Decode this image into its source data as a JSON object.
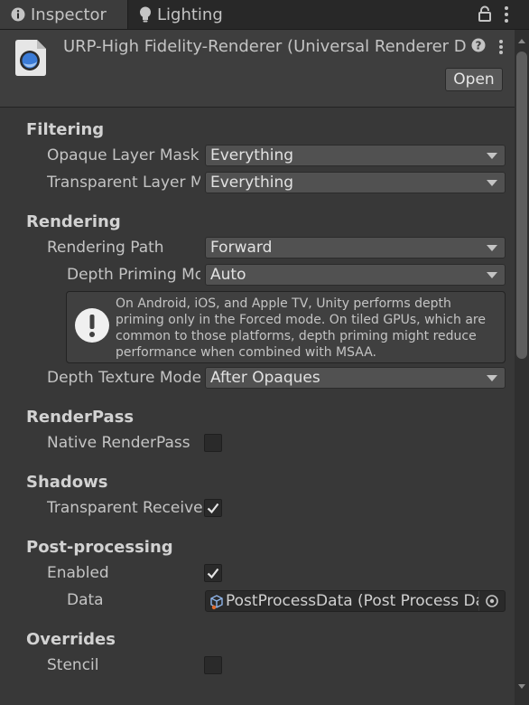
{
  "tabs": [
    {
      "label": "Inspector",
      "icon": "info-icon",
      "active": true
    },
    {
      "label": "Lighting",
      "icon": "lightbulb-icon",
      "active": false
    }
  ],
  "header": {
    "title": "URP-High Fidelity-Renderer (Universal Renderer Data)",
    "open_label": "Open"
  },
  "sections": {
    "filtering": "Filtering",
    "rendering": "Rendering",
    "renderpass": "RenderPass",
    "shadows": "Shadows",
    "postprocessing": "Post-processing",
    "overrides": "Overrides"
  },
  "fields": {
    "opaque_layer_mask": {
      "label": "Opaque Layer Mask",
      "value": "Everything"
    },
    "transparent_layer_mask": {
      "label": "Transparent Layer Mask",
      "value": "Everything"
    },
    "rendering_path": {
      "label": "Rendering Path",
      "value": "Forward"
    },
    "depth_priming_mode": {
      "label": "Depth Priming Mode",
      "value": "Auto"
    },
    "depth_texture_mode": {
      "label": "Depth Texture Mode",
      "value": "After Opaques"
    },
    "native_renderpass": {
      "label": "Native RenderPass",
      "checked": false
    },
    "transparent_receive_shadows": {
      "label": "Transparent Receive Shadows",
      "checked": true
    },
    "pp_enabled": {
      "label": "Enabled",
      "checked": true
    },
    "pp_data": {
      "label": "Data",
      "value": "PostProcessData (Post Process Data)"
    },
    "stencil": {
      "label": "Stencil",
      "checked": false
    }
  },
  "help_message": "On Android, iOS, and Apple TV, Unity performs depth priming only in the Forced mode. On tiled GPUs, which are common to those platforms, depth priming might reduce performance when combined with MSAA.",
  "colors": {
    "background": "#383838",
    "header": "#3e3e3e",
    "tabbar": "#282828",
    "text": "#c4c4c4",
    "accent_icon": "#3b7bd6"
  }
}
